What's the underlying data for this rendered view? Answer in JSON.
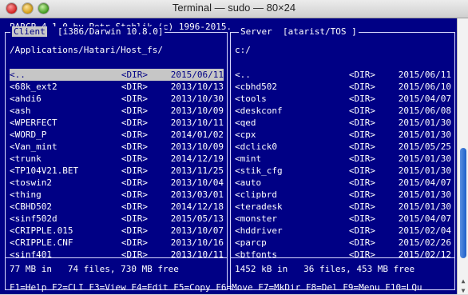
{
  "window": {
    "title": "Terminal — sudo — 80×24"
  },
  "header": "PARCP 4.1.0 by Petr Stehlik (c) 1996-2015.",
  "client": {
    "label": "Client",
    "system": "[i386/Darwin 10.8.0]",
    "path": "/Applications/Hatari/Host_fs/",
    "rows": [
      {
        "name": "<..",
        "type": "<DIR>",
        "date": "2015/06/11"
      },
      {
        "name": "<68k_ext2",
        "type": "<DIR>",
        "date": "2013/10/13"
      },
      {
        "name": "<ahdi6",
        "type": "<DIR>",
        "date": "2013/10/30"
      },
      {
        "name": "<ash",
        "type": "<DIR>",
        "date": "2013/10/09"
      },
      {
        "name": "<WPERFECT",
        "type": "<DIR>",
        "date": "2013/10/11"
      },
      {
        "name": "<WORD_P",
        "type": "<DIR>",
        "date": "2014/01/02"
      },
      {
        "name": "<Van_mint",
        "type": "<DIR>",
        "date": "2013/10/09"
      },
      {
        "name": "<trunk",
        "type": "<DIR>",
        "date": "2014/12/19"
      },
      {
        "name": "<TP104V21.BET",
        "type": "<DIR>",
        "date": "2013/11/25"
      },
      {
        "name": "<toswin2",
        "type": "<DIR>",
        "date": "2013/10/04"
      },
      {
        "name": "<thing",
        "type": "<DIR>",
        "date": "2013/03/01"
      },
      {
        "name": "<CBHD502",
        "type": "<DIR>",
        "date": "2014/12/18"
      },
      {
        "name": "<sinf502d",
        "type": "<DIR>",
        "date": "2015/05/13"
      },
      {
        "name": "<CRIPPLE.015",
        "type": "<DIR>",
        "date": "2013/10/07"
      },
      {
        "name": "<CRIPPLE.CNF",
        "type": "<DIR>",
        "date": "2013/10/16"
      },
      {
        "name": "<sinf401",
        "type": "<DIR>",
        "date": "2013/10/11"
      }
    ],
    "status": "77 MB in   74 files, 730 MB free"
  },
  "server": {
    "label": "Server",
    "system": "[atarist/TOS ]",
    "path": "c:/",
    "rows": [
      {
        "name": "<..",
        "type": "<DIR>",
        "date": "2015/06/11"
      },
      {
        "name": "<cbhd502",
        "type": "<DIR>",
        "date": "2015/06/10"
      },
      {
        "name": "<tools",
        "type": "<DIR>",
        "date": "2015/04/07"
      },
      {
        "name": "<deskconf",
        "type": "<DIR>",
        "date": "2015/06/08"
      },
      {
        "name": "<qed",
        "type": "<DIR>",
        "date": "2015/01/30"
      },
      {
        "name": "<cpx",
        "type": "<DIR>",
        "date": "2015/01/30"
      },
      {
        "name": "<dclick0",
        "type": "<DIR>",
        "date": "2015/05/25"
      },
      {
        "name": "<mint",
        "type": "<DIR>",
        "date": "2015/01/30"
      },
      {
        "name": "<stik_cfg",
        "type": "<DIR>",
        "date": "2015/01/30"
      },
      {
        "name": "<auto",
        "type": "<DIR>",
        "date": "2015/04/07"
      },
      {
        "name": "<clipbrd",
        "type": "<DIR>",
        "date": "2015/01/30"
      },
      {
        "name": "<teradesk",
        "type": "<DIR>",
        "date": "2015/01/30"
      },
      {
        "name": "<monster",
        "type": "<DIR>",
        "date": "2015/04/07"
      },
      {
        "name": "<hddriver",
        "type": "<DIR>",
        "date": "2015/02/04"
      },
      {
        "name": "<parcp",
        "type": "<DIR>",
        "date": "2015/02/26"
      },
      {
        "name": "<btfonts",
        "type": "<DIR>",
        "date": "2015/02/12"
      }
    ],
    "status": "1452 kB in   36 files, 453 MB free"
  },
  "fkeys": "F1=Help F2=CLI F3=View F4=Edit F5=Copy F6=Move F7=MkDir F8=Del F9=Menu F10=LQu",
  "colors": {
    "terminal_bg": "#000085",
    "text": "#ffffff",
    "selection_bg": "#c6c6c6"
  }
}
